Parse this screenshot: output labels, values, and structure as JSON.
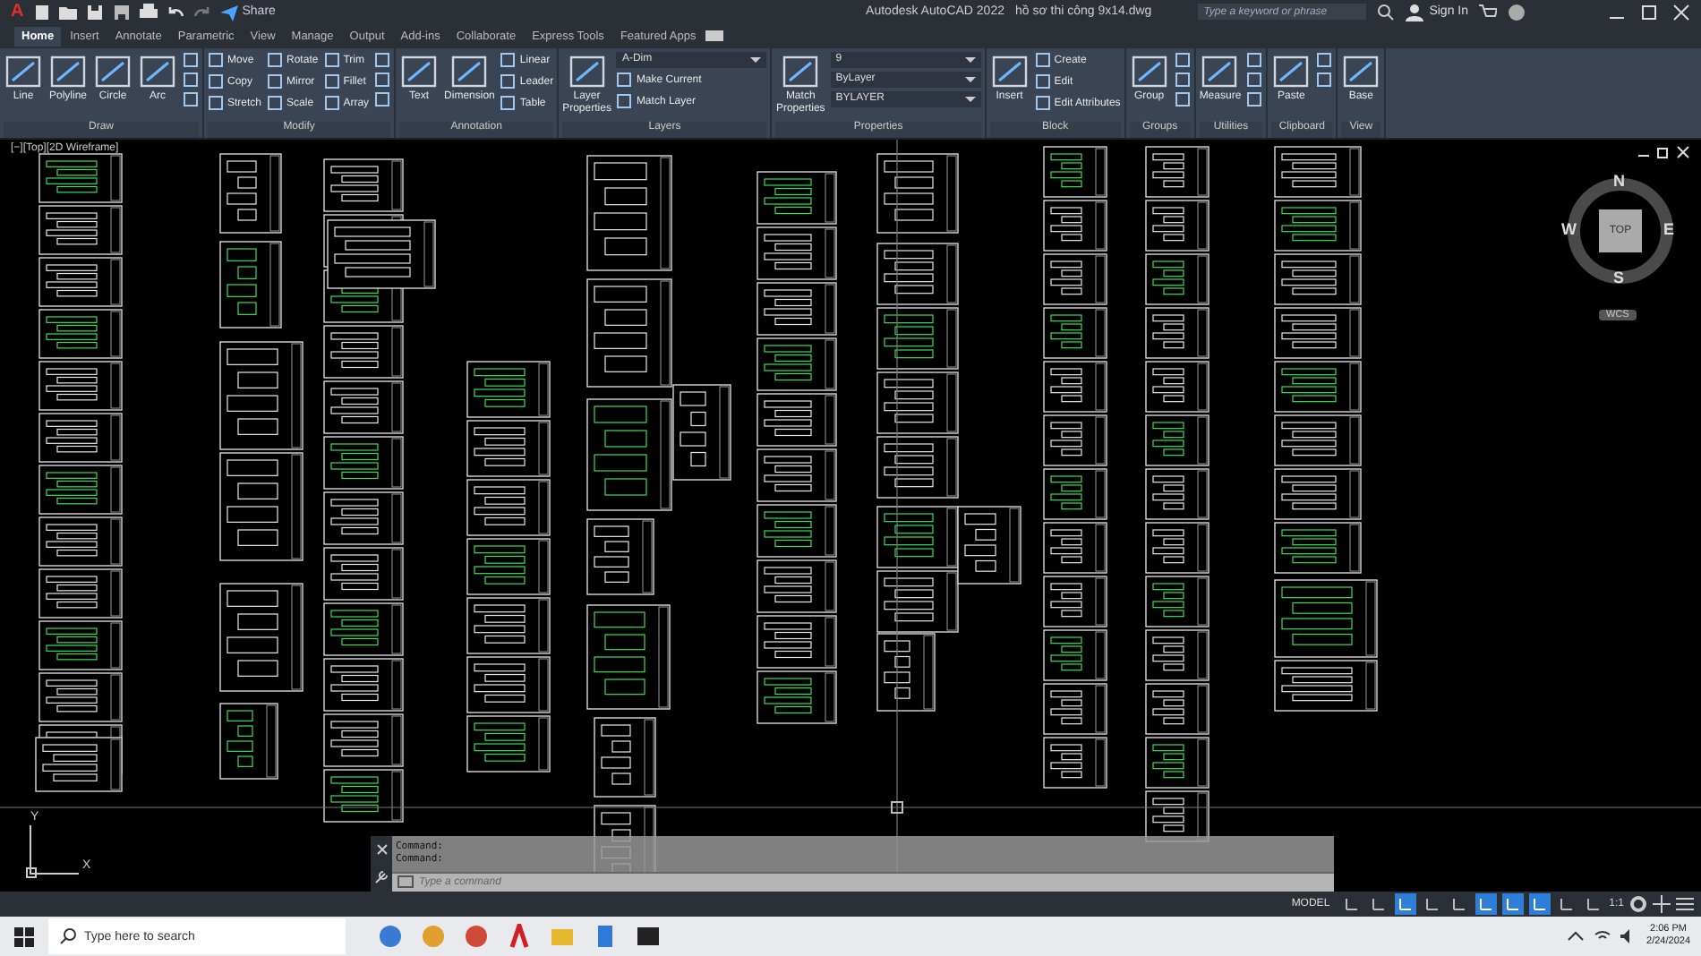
{
  "title_bar": {
    "app_menu": "A",
    "share": "Share",
    "title": "Autodesk AutoCAD 2022",
    "file": "hồ sơ thi công 9x14.dwg",
    "search": {
      "placeholder": "Type a keyword or phrase"
    },
    "sign_in": "Sign In"
  },
  "tabs": [
    {
      "label": "Home",
      "selected": true
    },
    {
      "label": "Insert",
      "selected": false
    },
    {
      "label": "Annotate",
      "selected": false
    },
    {
      "label": "Parametric",
      "selected": false
    },
    {
      "label": "View",
      "selected": false
    },
    {
      "label": "Manage",
      "selected": false
    },
    {
      "label": "Output",
      "selected": false
    },
    {
      "label": "Add-ins",
      "selected": false
    },
    {
      "label": "Collaborate",
      "selected": false
    },
    {
      "label": "Express Tools",
      "selected": false
    },
    {
      "label": "Featured Apps",
      "selected": false
    }
  ],
  "ribbon": [
    {
      "title": "Draw",
      "columns": [
        {
          "kind": "large",
          "label": "Line"
        },
        {
          "kind": "large",
          "label": "Polyline"
        },
        {
          "kind": "large",
          "label": "Circle"
        },
        {
          "kind": "large",
          "label": "Arc"
        },
        {
          "kind": "stack",
          "items": [
            {
              "kind": "icon"
            },
            {
              "kind": "icon"
            },
            {
              "kind": "icon"
            }
          ]
        }
      ]
    },
    {
      "title": "Modify",
      "columns": [
        {
          "kind": "stack",
          "items": [
            {
              "kind": "small",
              "label": "Move"
            },
            {
              "kind": "small",
              "label": "Copy"
            },
            {
              "kind": "small",
              "label": "Stretch"
            }
          ]
        },
        {
          "kind": "stack",
          "items": [
            {
              "kind": "small",
              "label": "Rotate"
            },
            {
              "kind": "small",
              "label": "Mirror"
            },
            {
              "kind": "small",
              "label": "Scale"
            }
          ]
        },
        {
          "kind": "stack",
          "items": [
            {
              "kind": "small",
              "label": "Trim"
            },
            {
              "kind": "small",
              "label": "Fillet"
            },
            {
              "kind": "small",
              "label": "Array"
            }
          ]
        },
        {
          "kind": "stack",
          "items": [
            {
              "kind": "icon"
            },
            {
              "kind": "icon"
            },
            {
              "kind": "icon"
            }
          ]
        }
      ]
    },
    {
      "title": "Annotation",
      "columns": [
        {
          "kind": "large",
          "label": "Text"
        },
        {
          "kind": "large",
          "label": "Dimension"
        },
        {
          "kind": "stack",
          "items": [
            {
              "kind": "small",
              "label": "Linear"
            },
            {
              "kind": "small",
              "label": "Leader"
            },
            {
              "kind": "small",
              "label": "Table"
            }
          ]
        }
      ]
    },
    {
      "title": "Layers",
      "columns": [
        {
          "kind": "large",
          "label": "Layer Properties"
        },
        {
          "kind": "stack",
          "items": [
            {
              "kind": "select",
              "value": "A-Dim"
            },
            {
              "kind": "small",
              "label": "Make Current"
            },
            {
              "kind": "small",
              "label": "Match Layer"
            }
          ]
        }
      ]
    },
    {
      "title": "Properties",
      "columns": [
        {
          "kind": "large",
          "label": "Match Properties"
        },
        {
          "kind": "stack",
          "items": [
            {
              "kind": "select",
              "value": "9"
            },
            {
              "kind": "select",
              "value": "ByLayer"
            },
            {
              "kind": "select",
              "value": "BYLAYER"
            }
          ]
        }
      ]
    },
    {
      "title": "Block",
      "columns": [
        {
          "kind": "large",
          "label": "Insert"
        },
        {
          "kind": "stack",
          "items": [
            {
              "kind": "small",
              "label": "Create"
            },
            {
              "kind": "small",
              "label": "Edit"
            },
            {
              "kind": "small",
              "label": "Edit Attributes"
            }
          ]
        }
      ]
    },
    {
      "title": "Groups",
      "columns": [
        {
          "kind": "large",
          "label": "Group"
        },
        {
          "kind": "stack",
          "items": [
            {
              "kind": "icon"
            },
            {
              "kind": "icon"
            },
            {
              "kind": "icon"
            }
          ]
        }
      ]
    },
    {
      "title": "Utilities",
      "columns": [
        {
          "kind": "large",
          "label": "Measure"
        },
        {
          "kind": "stack",
          "items": [
            {
              "kind": "icon"
            },
            {
              "kind": "icon"
            },
            {
              "kind": "icon"
            }
          ]
        }
      ]
    },
    {
      "title": "Clipboard",
      "columns": [
        {
          "kind": "large",
          "label": "Paste"
        },
        {
          "kind": "stack",
          "items": [
            {
              "kind": "icon"
            },
            {
              "kind": "icon"
            }
          ]
        }
      ]
    },
    {
      "title": "View",
      "columns": [
        {
          "kind": "large",
          "label": "Base"
        }
      ]
    }
  ],
  "viewport": {
    "label": "[−][Top][2D Wireframe]",
    "compass": {
      "north": "N",
      "south": "S",
      "east": "E",
      "west": "W",
      "face": "TOP",
      "ucs": "WCS"
    },
    "axis_x": "X",
    "axis_y": "Y"
  },
  "command_window": {
    "history": [
      "Command:",
      "Command:"
    ],
    "placeholder": "Type a command"
  },
  "status_bar": {
    "space": "MODEL",
    "scale": "1:1",
    "toggles": [
      {
        "on": false
      },
      {
        "on": false
      },
      {
        "on": true
      },
      {
        "on": false
      },
      {
        "on": false
      },
      {
        "on": true
      },
      {
        "on": true
      },
      {
        "on": true
      },
      {
        "on": false
      },
      {
        "on": false
      }
    ]
  },
  "taskbar": {
    "search": {
      "placeholder": "Type here to search"
    },
    "time": "2:06 PM",
    "date": "2/24/2024"
  }
}
